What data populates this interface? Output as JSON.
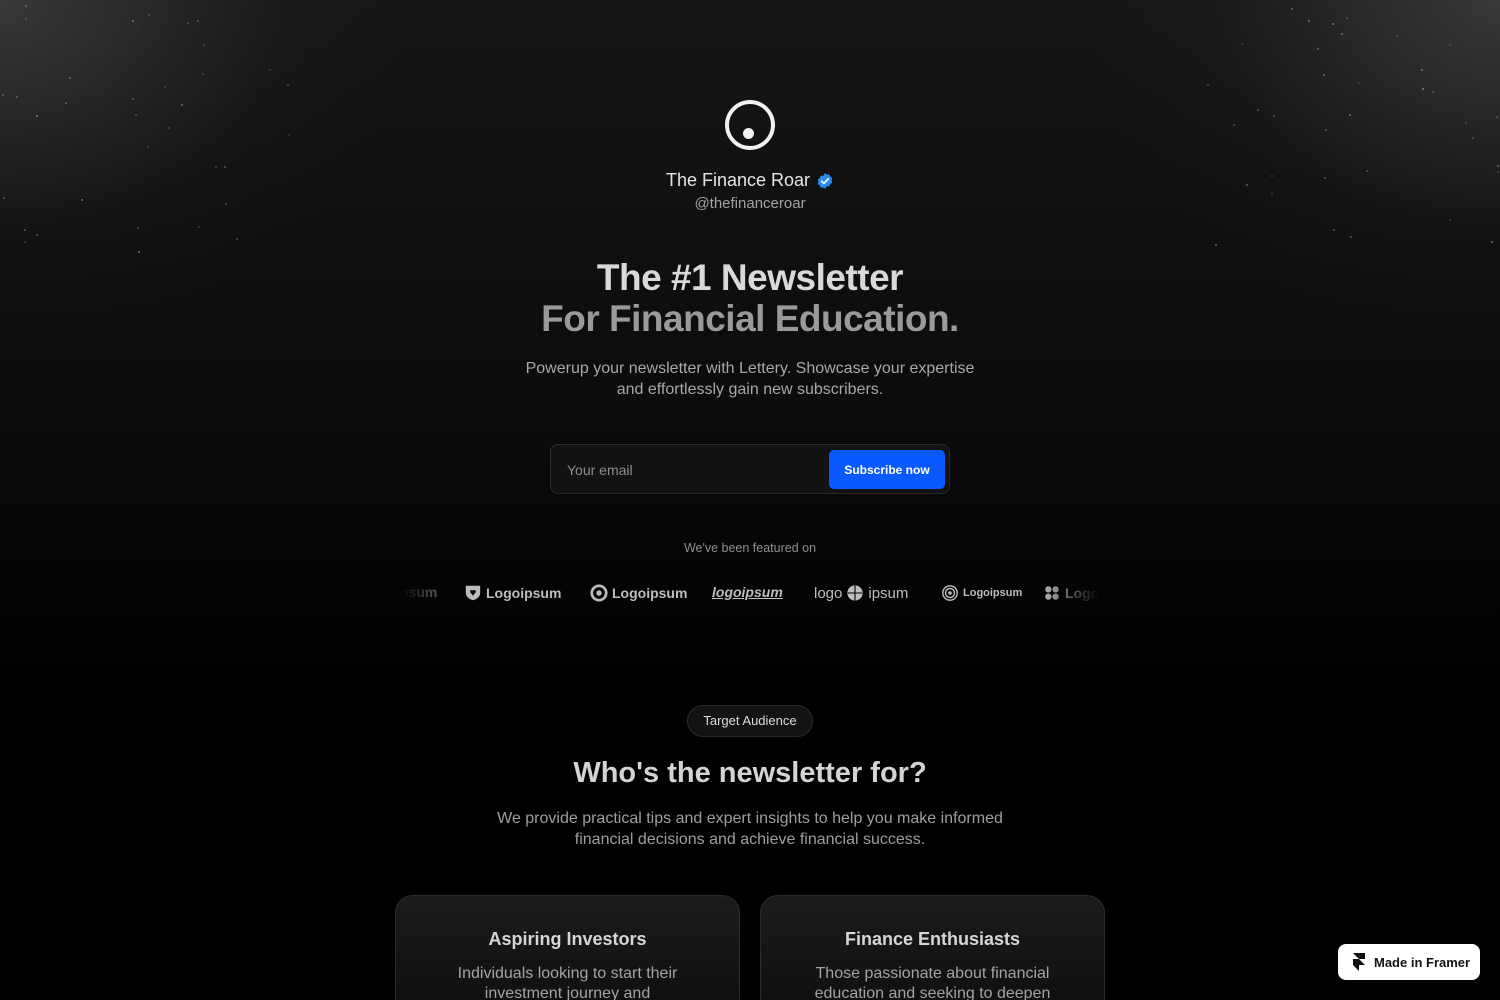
{
  "profile": {
    "name": "The Finance Roar",
    "handle": "@thefinanceroar",
    "verified_color": "#2b8cf5"
  },
  "hero": {
    "title_line1": "The #1 Newsletter",
    "title_line2": "For Financial Education.",
    "subtitle": "Powerup your newsletter with Lettery. Showcase your expertise and effortlessly gain new subscribers."
  },
  "signup": {
    "email_placeholder": "Your email",
    "email_value": "",
    "button_label": "Subscribe now",
    "button_color": "#0a59ff"
  },
  "featured": {
    "label": "We've been featured on",
    "logos": [
      {
        "text": "psum",
        "icon": "partial-logo"
      },
      {
        "text": "Logoipsum",
        "icon": "shield-logo-icon"
      },
      {
        "text": "Logoipsum",
        "icon": "ring-logo-icon"
      },
      {
        "text": "logoipsum",
        "icon": "wordmark-logo"
      },
      {
        "text": "ipsum",
        "prefix": "logo",
        "icon": "globe-logo-icon"
      },
      {
        "text": "Logoipsum",
        "icon": "spiral-logo-icon"
      },
      {
        "text": "Logo",
        "icon": "flower-logo-icon"
      }
    ]
  },
  "audience": {
    "pill": "Target Audience",
    "title": "Who's the newsletter for?",
    "subtitle": "We provide practical tips and expert insights to help you make informed financial decisions and achieve financial success.",
    "cards": [
      {
        "title": "Aspiring Investors",
        "text": "Individuals looking to start their investment journey and"
      },
      {
        "title": "Finance Enthusiasts",
        "text": "Those passionate about financial education and seeking to deepen"
      }
    ]
  },
  "badge": {
    "label": "Made in Framer"
  }
}
